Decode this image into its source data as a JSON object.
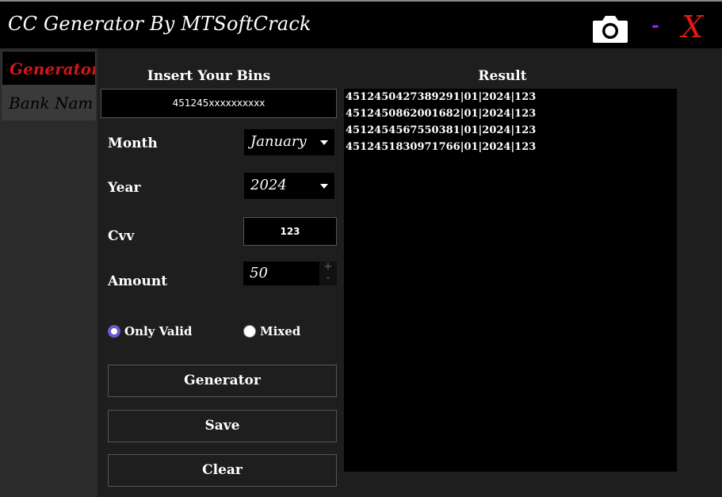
{
  "window": {
    "title": "CC Generator By MTSoftCrack",
    "camera_icon": "camera-icon",
    "minimize_label": "-",
    "close_label": "X",
    "close_color": "#e01818",
    "minimize_color": "#a020f0"
  },
  "sidebar": {
    "items": [
      {
        "label": "Generator",
        "active": true
      },
      {
        "label": "Bank Nam",
        "active": false
      }
    ],
    "accent": "#d01818"
  },
  "form": {
    "bins_heading": "Insert Your Bins",
    "bins_value": "451245xxxxxxxxxx",
    "month_label": "Month",
    "month_value": "January",
    "year_label": "Year",
    "year_value": "2024",
    "cvv_label": "Cvv",
    "cvv_value": "123",
    "amount_label": "Amount",
    "amount_value": "50",
    "spin_up": "+",
    "spin_down": "-",
    "radio_only_valid": "Only Valid",
    "radio_mixed": "Mixed",
    "selected_mode": "Only Valid",
    "radio_color": "#6a5acd"
  },
  "buttons": {
    "generator": "Generator",
    "save": "Save",
    "clear": "Clear"
  },
  "result": {
    "heading": "Result",
    "lines": [
      "4512450427389291|01|2024|123",
      "4512450862001682|01|2024|123",
      "4512454567550381|01|2024|123",
      "4512451830971766|01|2024|123"
    ]
  }
}
